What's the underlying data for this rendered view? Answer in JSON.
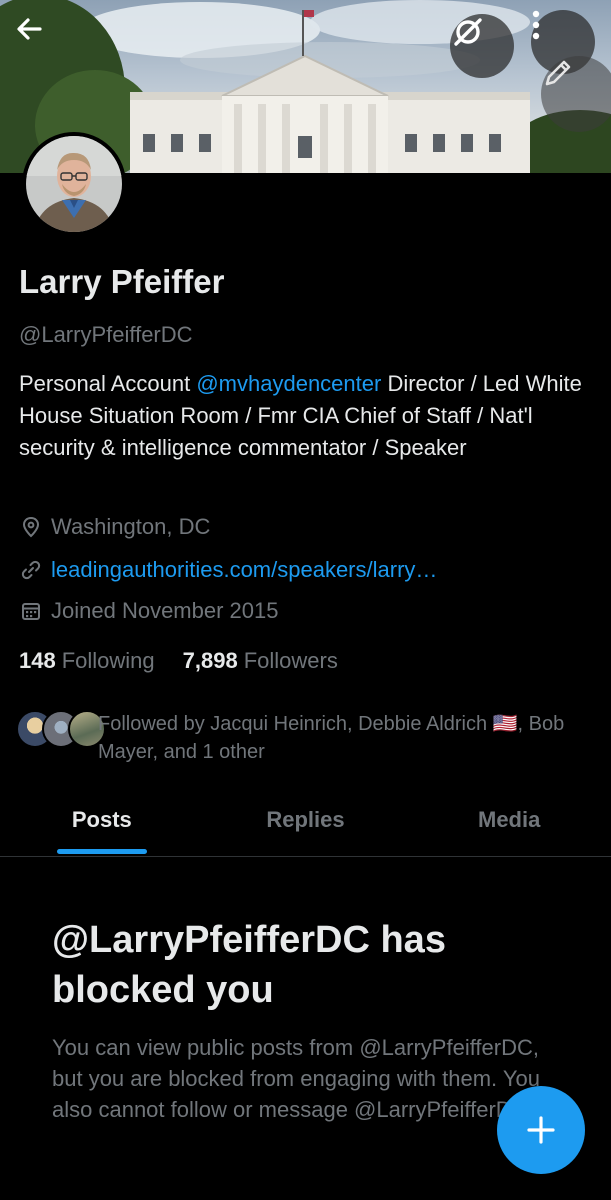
{
  "profile": {
    "name": "Larry Pfeiffer",
    "handle": "@LarryPfeifferDC",
    "bio_prefix": "Personal Account ",
    "bio_mention": "@mvhaydencenter",
    "bio_suffix": " Director / Led White House Situation Room / Fmr CIA Chief of Staff / Nat'l security & intelligence commentator / Speaker",
    "location": "Washington, DC",
    "website": "leadingauthorities.com/speakers/larry…",
    "joined": "Joined November 2015"
  },
  "stats": {
    "following_count": "148",
    "following_label": "Following",
    "followers_count": "7,898",
    "followers_label": "Followers"
  },
  "followed_by": {
    "text": "Followed by Jacqui Heinrich, Debbie Aldrich 🇺🇸, Bob Mayer, and 1 other"
  },
  "tabs": [
    {
      "label": "Posts",
      "active": true
    },
    {
      "label": "Replies",
      "active": false
    },
    {
      "label": "Media",
      "active": false
    }
  ],
  "blocked": {
    "title": "@LarryPfeifferDC has blocked you",
    "body": "You can view public posts from @LarryPfeifferDC, but you are blocked from engaging with them. You also cannot follow or message @LarryPfeifferDC."
  },
  "icons": {
    "back": "arrow-left-icon",
    "disconnect": "slashed-circle-icon",
    "more": "vertical-dots-icon",
    "edit": "pencil-icon",
    "location": "location-pin-icon",
    "link": "link-icon",
    "calendar": "calendar-icon",
    "compose": "plus-icon"
  },
  "colors": {
    "background": "#000000",
    "accent": "#1d9bf0",
    "text_primary": "#e7e9ea",
    "text_secondary": "#71767b"
  }
}
